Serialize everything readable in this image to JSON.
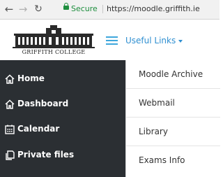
{
  "browser": {
    "secure_label": "Secure",
    "url": "https://moodle.griffith.ie"
  },
  "header": {
    "logo_text": "GRIFFITH COLLEGE",
    "useful_links_label": "Useful Links"
  },
  "sidebar": {
    "items": [
      {
        "label": "Home",
        "icon": "home-icon"
      },
      {
        "label": "Dashboard",
        "icon": "home-icon"
      },
      {
        "label": "Calendar",
        "icon": "calendar-icon"
      },
      {
        "label": "Private files",
        "icon": "files-icon"
      }
    ]
  },
  "dropdown": {
    "items": [
      {
        "label": "Moodle Archive"
      },
      {
        "label": "Webmail"
      },
      {
        "label": "Library"
      },
      {
        "label": "Exams Info"
      }
    ]
  },
  "colors": {
    "sidebar_bg": "#2b2f33",
    "link_blue": "#2f8fd1",
    "secure_green": "#1e8e3e"
  }
}
